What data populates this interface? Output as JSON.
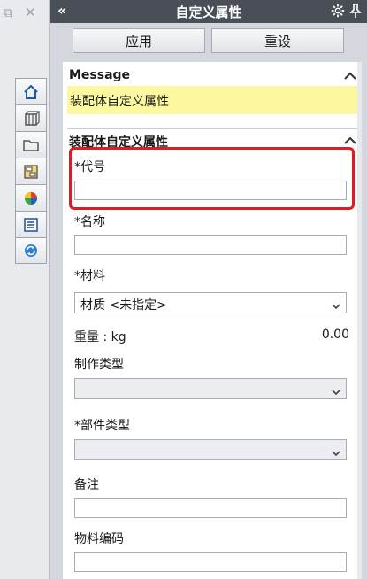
{
  "rail": {
    "restore_glyph": "⧉",
    "close_glyph": "✕",
    "tabs": [
      {
        "name": "home-icon"
      },
      {
        "name": "parts-icon"
      },
      {
        "name": "folder-icon"
      },
      {
        "name": "structure-icon"
      },
      {
        "name": "appearance-icon"
      },
      {
        "name": "properties-icon"
      },
      {
        "name": "sync-icon"
      }
    ]
  },
  "panel": {
    "collapse_glyph": "«",
    "title": "自定义属性",
    "apply_label": "应用",
    "reset_label": "重设"
  },
  "message": {
    "heading": "Message",
    "text": "装配体自定义属性"
  },
  "properties": {
    "heading": "装配体自定义属性",
    "code_label": "*代号",
    "code_value": "",
    "name_label": "*名称",
    "name_value": "",
    "material_label": "*材料",
    "material_value": "材质 <未指定>",
    "weight_label": "重量 : kg",
    "weight_value": "0.00",
    "make_type_label": "制作类型",
    "make_type_value": "",
    "part_type_label": "*部件类型",
    "part_type_value": "",
    "remark_label": "备注",
    "remark_value": "",
    "material_code_label": "物料编码",
    "material_code_value": ""
  },
  "colors": {
    "title_bar": "#4a4f57",
    "message_bg": "#fcf8a0",
    "highlight": "#e01b24"
  }
}
